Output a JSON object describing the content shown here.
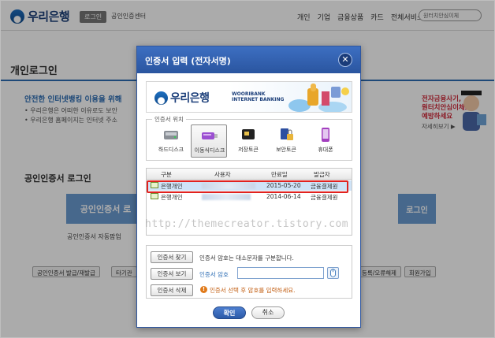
{
  "header": {
    "logo_text": "우리은행",
    "login_badge": "로그인",
    "cert_center": "공인인증센터",
    "nav": [
      "개인",
      "기업",
      "금융상품",
      "카드",
      "전체서비스 ▾"
    ],
    "search_placeholder": "원터치안심이체"
  },
  "page": {
    "title": "개인로그인",
    "notice_head": "안전한 인터넷뱅킹 이용을 위해",
    "notice_lines": [
      "• 우리은행은 어떠한 이유로도 보안",
      "• 우리은행 홈페이지는 인터넷 주소"
    ],
    "promo_lines": [
      "전자금융사기,",
      "원터치안심이체로",
      "예방하세요"
    ],
    "promo_more": "자세히보기 ▶",
    "cert_login_title": "공인인증서 로그인",
    "cert_button": "공인인증서 로",
    "login_button": "로그인",
    "auto_popup": "공인인증서 자동팝업",
    "bottom_buttons": [
      "공인인증서 발급/재발급",
      "타기관",
      "등록/오류해제",
      "회원가입"
    ]
  },
  "dialog": {
    "title": "인증서 입력 (전자서명)",
    "close_label": "✕",
    "banner": {
      "logo_text": "우리은행",
      "sub_lines": [
        "WOORIBANK",
        "INTERNET BANKING"
      ]
    },
    "storage_legend": "인증서 위치",
    "storage": [
      {
        "label": "하드디스크",
        "icon": "hard-disk-icon",
        "selected": false
      },
      {
        "label": "이동식디스크",
        "icon": "removable-disk-icon",
        "selected": true
      },
      {
        "label": "저장토큰",
        "icon": "token-icon",
        "selected": false
      },
      {
        "label": "보안토큰",
        "icon": "security-token-icon",
        "selected": false
      },
      {
        "label": "휴대폰",
        "icon": "phone-icon",
        "selected": false
      }
    ],
    "table": {
      "headers": [
        "구분",
        "사용자",
        "만료일",
        "발급자"
      ],
      "rows": [
        {
          "type": "은행개인",
          "user": "",
          "expiry": "2015-05-20",
          "issuer": "금융결제원",
          "selected": true
        },
        {
          "type": "은행개인",
          "user": "",
          "expiry": "2014-06-14",
          "issuer": "금융결제원",
          "selected": false
        }
      ]
    },
    "watermark": "http://themecreator.tistory.com",
    "buttons": {
      "find": "인증서 찾기",
      "view": "인증서 보기",
      "delete": "인증서 삭제",
      "ok": "확인",
      "cancel": "취소"
    },
    "case_hint": "인증서 암호는 대소문자를 구분합니다.",
    "password_label": "인증서 암호",
    "password_value": "",
    "warning": "인증서 선택 후 암호를 입력하세요."
  },
  "colors": {
    "brand": "#2a559f",
    "selected_row": "#cfe3f7",
    "highlight_border": "#e0221f",
    "warning": "#c25d10"
  }
}
